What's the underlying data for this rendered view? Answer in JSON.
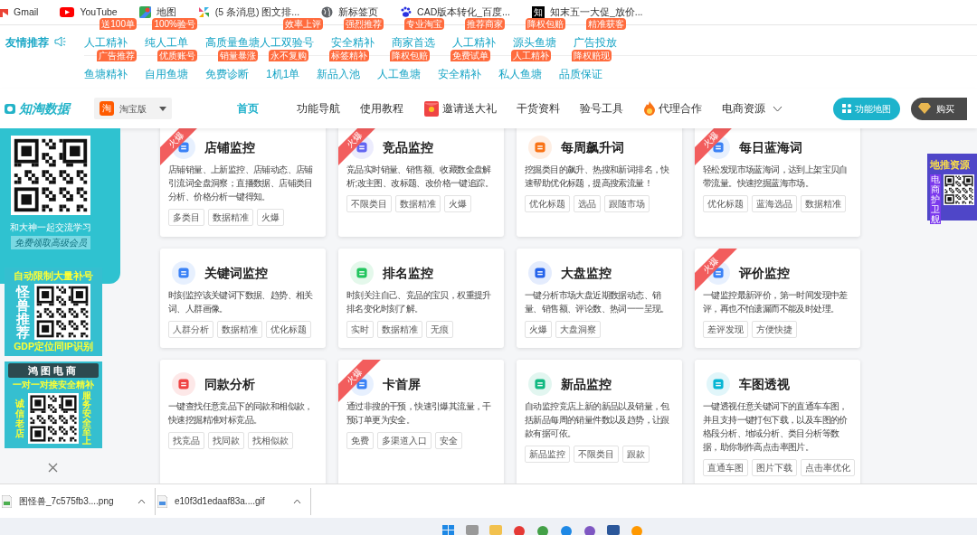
{
  "bookmarks": [
    {
      "label": "Gmail",
      "kind": "gmail"
    },
    {
      "label": "YouTube",
      "kind": "youtube"
    },
    {
      "label": "地图",
      "kind": "maps"
    },
    {
      "label": "(5 条消息) 图文排...",
      "kind": "pinwheel"
    },
    {
      "label": "新标签页",
      "kind": "globe"
    },
    {
      "label": "CAD版本转化_百度...",
      "kind": "paw"
    },
    {
      "label": "知末五一大促_放价...",
      "kind": "letter",
      "icon_text": "知"
    }
  ],
  "friend_links": {
    "label": "友情推荐",
    "rows": [
      {
        "links": [
          {
            "text": "人工精补",
            "badge": "送100单"
          },
          {
            "text": "纯人工单",
            "badge": "100%验号"
          },
          {
            "text": "高质量鱼塘人工双验号",
            "badge": "效率上评"
          },
          {
            "text": "安全精补",
            "badge": "强烈推荐"
          },
          {
            "text": "商家首选",
            "badge": "专业淘宝"
          },
          {
            "text": "人工精补",
            "badge": "推荐商家"
          },
          {
            "text": "源头鱼塘",
            "badge": "降权包赔"
          },
          {
            "text": "广告投放",
            "badge": "精准获客"
          }
        ]
      },
      {
        "links": [
          {
            "text": "鱼塘精补",
            "badge": "广告推荐"
          },
          {
            "text": "自用鱼塘",
            "badge": "优质账号"
          },
          {
            "text": "免费诊断",
            "badge": "销量暴涨"
          },
          {
            "text": "1机1单",
            "badge": "永不复购"
          },
          {
            "text": "新品入池",
            "badge": "标签精补"
          },
          {
            "text": "人工鱼塘",
            "badge": "降权包赔"
          },
          {
            "text": "安全精补",
            "badge": "免费试单"
          },
          {
            "text": "私人鱼塘",
            "badge": "人工精补"
          },
          {
            "text": "品质保证",
            "badge": "降权赔现"
          }
        ]
      }
    ]
  },
  "nav": {
    "logo": "知淘数据",
    "platform": {
      "icon_text": "淘",
      "label": "淘宝版"
    },
    "items": [
      {
        "label": "首页",
        "selected": true,
        "kind": "plain"
      },
      {
        "label": "功能导航",
        "selected": false,
        "kind": "plain"
      },
      {
        "label": "使用教程",
        "selected": false,
        "kind": "plain"
      },
      {
        "label": "邀请送大礼",
        "selected": false,
        "kind": "gift"
      },
      {
        "label": "干货资料",
        "selected": false,
        "kind": "plain"
      },
      {
        "label": "验号工具",
        "selected": false,
        "kind": "plain"
      },
      {
        "label": "代理合作",
        "selected": false,
        "kind": "flame"
      },
      {
        "label": "电商资源",
        "selected": false,
        "kind": "dropdown"
      }
    ],
    "buttons": [
      {
        "label": "功能地图",
        "kind": "primary"
      },
      {
        "label": "购买",
        "kind": "dark"
      }
    ]
  },
  "cards": [
    {
      "title": "店铺监控",
      "hot_label": "火爆",
      "color": "#3b82f6",
      "desc": "店铺销量、上新监控、店铺动态、店铺引流词全盘洞察；直播数据、店铺类目分析、价格分析一键得知。",
      "tags": [
        "多类目",
        "数据精准",
        "火爆"
      ]
    },
    {
      "title": "竞品监控",
      "hot_label": "火爆",
      "color": "#6366f1",
      "desc": "竞品实时销量、销售额、收藏数全盘解析;改主图、改标题、改价格一键追踪。",
      "tags": [
        "不限类目",
        "数据精准",
        "火爆"
      ]
    },
    {
      "title": "每周飙升词",
      "color": "#f97316",
      "desc": "挖掘类目的飙升、热搜和新词排名，快速帮助优化标题，提高搜索流量！",
      "tags": [
        "优化标题",
        "选品",
        "跟随市场"
      ]
    },
    {
      "title": "每日蓝海词",
      "hot_label": "火爆",
      "color": "#3b82f6",
      "desc": "轻松发现市场蓝海词，达到上架宝贝自带流量。快速挖掘蓝海市场。",
      "tags": [
        "优化标题",
        "蓝海选品",
        "数据精准"
      ]
    },
    {
      "title": "关键词监控",
      "color": "#3b82f6",
      "desc": "时刻监控该关键词下数据、趋势、相关词、人群画像。",
      "tags": [
        "人群分析",
        "数据精准",
        "优化标题"
      ]
    },
    {
      "title": "排名监控",
      "color": "#22c55e",
      "desc": "时刻关注自己、竞品的宝贝，权重提升排名变化时刻了解。",
      "tags": [
        "实时",
        "数据精准",
        "无痕"
      ]
    },
    {
      "title": "大盘监控",
      "color": "#2563eb",
      "desc": "一键分析市场大盘近期数据动态、销量、销售额、评论数、热词一一呈现。",
      "tags": [
        "火爆",
        "大盘洞察"
      ]
    },
    {
      "title": "评价监控",
      "hot_label": "火爆",
      "color": "#3b82f6",
      "desc": "一键监控最新评价，第一时间发现中差评，再也不怕遗漏而不能及时处理。",
      "tags": [
        "差评发现",
        "方便快捷"
      ]
    },
    {
      "title": "同款分析",
      "color": "#ef4444",
      "desc": "一键查找任意竞品下的同款和相似款，快速挖掘精准对标竞品。",
      "tags": [
        "找竞品",
        "找同款",
        "找相似款"
      ]
    },
    {
      "title": "卡首屏",
      "hot_label": "火爆",
      "color": "#3b82f6",
      "desc": "通过非搜的干预，快速引爆其流量，干预订单更为安全。",
      "tags": [
        "免费",
        "多渠道入口",
        "安全"
      ]
    },
    {
      "title": "新品监控",
      "color": "#10b981",
      "desc": "自动监控竞店上新的新品以及销量，包括新品每周的销量件数以及趋势，让跟款有据可依。",
      "tags": [
        "新品监控",
        "不限类目",
        "跟款"
      ]
    },
    {
      "title": "车图透视",
      "color": "#06b6d4",
      "desc": "一键透视任意关键词下的直通车车图，并且支持一键打包下载，以及车图的价格段分析、地域分析、类目分析等数据，助你制作高点击率图片。",
      "tags": [
        "直通车图",
        "图片下载",
        "点击率优化"
      ]
    }
  ],
  "side_ads": {
    "group": {
      "caption": "和大神一起交流学习",
      "note": "免费领取高级会员"
    },
    "monster": {
      "top": "自动限制大量补号",
      "side": "怪兽推荐",
      "bottom": "GDP定位同IP识别"
    },
    "hongtu": {
      "title": "鸿图电商",
      "subtitle": "一对一对接安全精补",
      "left": "诚信老店",
      "right": "服务安全至上"
    },
    "right": {
      "title": "地推资源",
      "side": "电商护卫舰"
    }
  },
  "downloads": [
    {
      "name": "图怪兽_7c575fb3....png",
      "kind": "image"
    },
    {
      "name": "e10f3d1edaaf83a....gif",
      "kind": "gif"
    }
  ]
}
